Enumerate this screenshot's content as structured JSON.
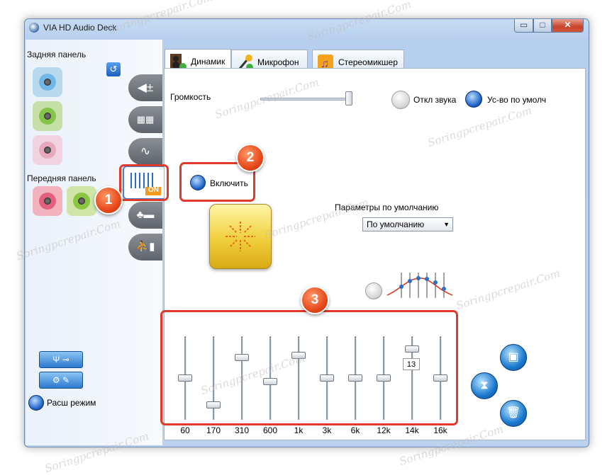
{
  "window": {
    "title": "VIA HD Audio Deck"
  },
  "caption_buttons": {
    "minimize": "▭",
    "maximize": "□",
    "close": "✕"
  },
  "sidebar": {
    "back_panel_label": "Задняя панель",
    "front_panel_label": "Передняя панель",
    "advanced_mode_label": "Расш режим",
    "eq_badge": "ON",
    "back_jacks": [
      {
        "name": "blue",
        "color": "#6fb8e8"
      },
      {
        "name": "green",
        "color": "#86c34a"
      },
      {
        "name": "pink",
        "color": "#e7a8c0"
      }
    ],
    "front_jacks": [
      {
        "name": "pink",
        "color": "#e3607e"
      },
      {
        "name": "green",
        "color": "#8cc640"
      }
    ]
  },
  "tabs": [
    {
      "label": "Динамик",
      "active": true
    },
    {
      "label": "Микрофон",
      "active": false
    },
    {
      "label": "Стереомикшер",
      "active": false
    }
  ],
  "volume": {
    "label": "Громкость",
    "level_percent": 96,
    "mute_label": "Откл звука",
    "default_device_label": "Ус-во по умолч"
  },
  "equalizer": {
    "enable_label": "Включить",
    "defaults_label": "Параметры по умолчанию",
    "preset_value": "По умолчанию",
    "tooltip_value": "13",
    "bands": [
      {
        "label": "60",
        "level": 0.5
      },
      {
        "label": "170",
        "level": 0.15
      },
      {
        "label": "310",
        "level": 0.77
      },
      {
        "label": "600",
        "level": 0.45
      },
      {
        "label": "1k",
        "level": 0.8
      },
      {
        "label": "3k",
        "level": 0.5
      },
      {
        "label": "6k",
        "level": 0.5
      },
      {
        "label": "12k",
        "level": 0.5
      },
      {
        "label": "14k",
        "level": 0.88
      },
      {
        "label": "16k",
        "level": 0.5
      }
    ]
  },
  "callouts": {
    "one": "1",
    "two": "2",
    "three": "3"
  },
  "watermark": "Soringpcrepair.Com",
  "colors": {
    "accent_blue": "#1e63c8",
    "callout_orange": "#e8491a",
    "highlight_red": "#e23a2a",
    "eq_yellow": "#f0cf3c"
  }
}
